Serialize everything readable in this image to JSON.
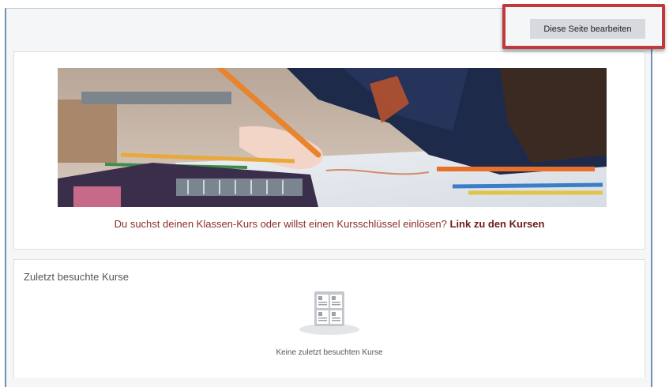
{
  "toolbar": {
    "edit_page_label": "Diese Seite bearbeiten"
  },
  "hero": {
    "image_alt": "Kind zeichnet mit Buntstiften",
    "caption_text": "Du suchst deinen Klassen-Kurs oder willst einen Kursschlüssel einlösen?",
    "caption_link": "Link zu den Kursen"
  },
  "recent_courses": {
    "title": "Zuletzt besuchte Kurse",
    "empty_icon": "courses-grid-icon",
    "empty_message": "Keine zuletzt besuchten Kurse"
  },
  "colors": {
    "highlight_border": "#c0393b",
    "link_color": "#6d1a1a",
    "caption_color": "#8a2b2b",
    "frame_border": "#6f8fb8"
  }
}
